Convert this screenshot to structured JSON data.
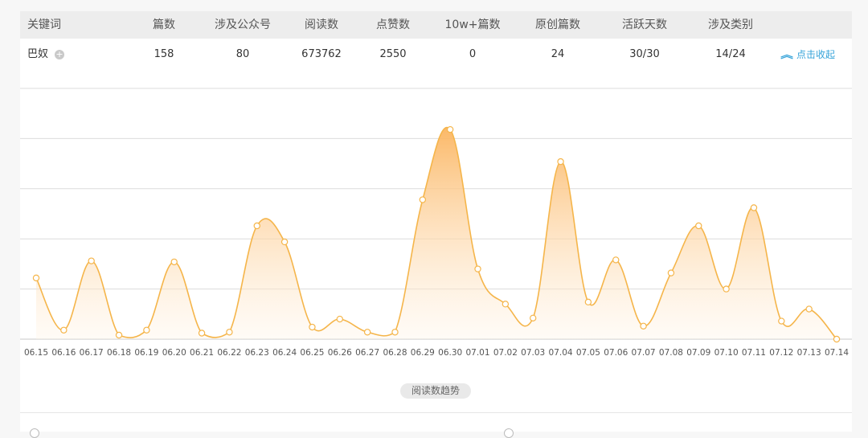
{
  "table": {
    "headers": [
      "关键词",
      "篇数",
      "涉及公众号",
      "阅读数",
      "点赞数",
      "10w+篇数",
      "原创篇数",
      "活跃天数",
      "涉及类别"
    ],
    "row": {
      "keyword": "巴奴",
      "articles": "158",
      "accounts": "80",
      "reads": "673762",
      "likes": "2550",
      "over100k": "0",
      "original": "24",
      "active_days": "30/30",
      "categories": "14/24"
    },
    "collapse_label": "点击收起",
    "plus_glyph": "+",
    "chevron_glyph": "︽"
  },
  "legend_label": "阅读数趋势",
  "chart_data": {
    "type": "area",
    "x": [
      "06.15",
      "06.16",
      "06.17",
      "06.18",
      "06.19",
      "06.20",
      "06.21",
      "06.22",
      "06.23",
      "06.24",
      "06.25",
      "06.26",
      "06.27",
      "06.28",
      "06.29",
      "06.30",
      "07.01",
      "07.02",
      "07.03",
      "07.04",
      "07.05",
      "07.06",
      "07.07",
      "07.08",
      "07.09",
      "07.10",
      "07.11",
      "07.12",
      "07.13",
      "07.14"
    ],
    "series": [
      {
        "values": [
          61,
          9,
          78,
          4,
          9,
          77,
          6,
          7,
          113,
          97,
          12,
          20,
          7,
          7,
          139,
          209,
          70,
          35,
          21,
          177,
          37,
          79,
          13,
          66,
          113,
          50,
          131,
          18,
          30,
          0
        ]
      }
    ],
    "ylim": [
      0,
      250
    ],
    "grid": true,
    "colors": {
      "line": "#f5b54a",
      "fill_top": "#fbb560",
      "fill_bottom": "#fff4e6",
      "grid": "#dcdcdc",
      "axis": "#c8c8c8",
      "tick": "#555555"
    }
  }
}
